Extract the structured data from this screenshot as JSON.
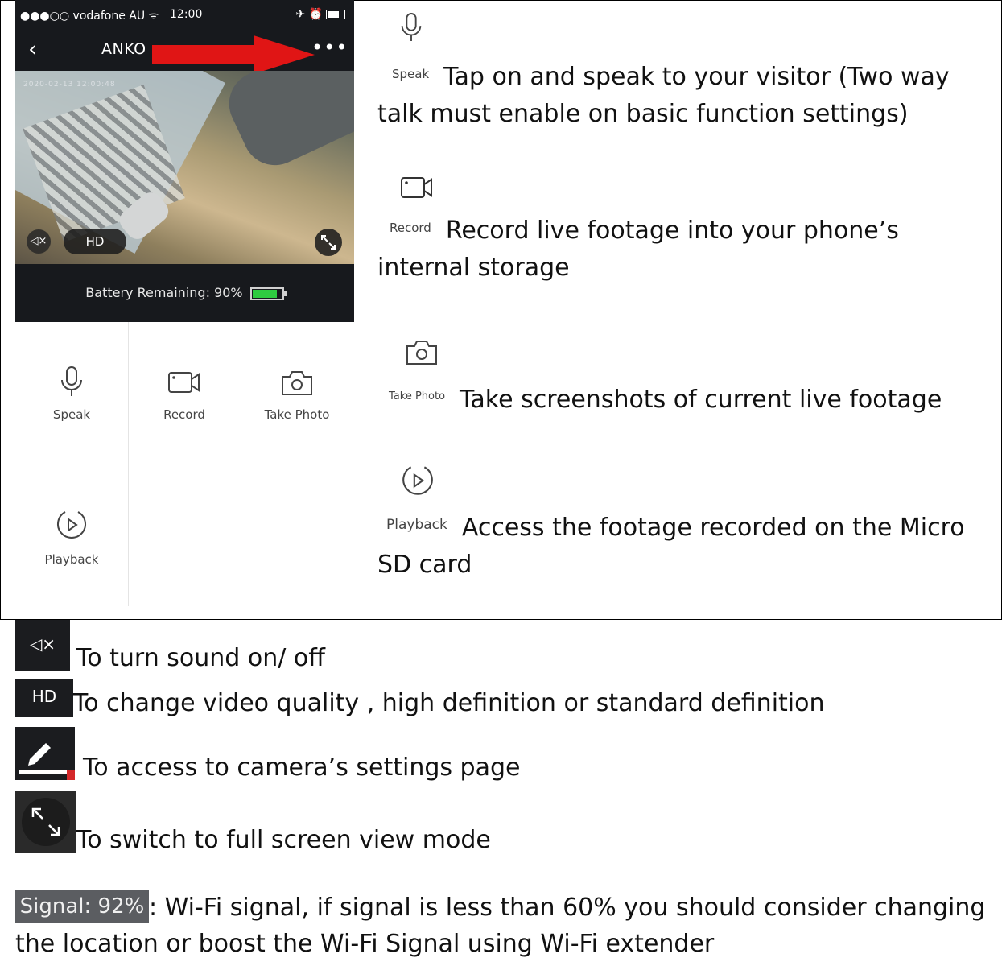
{
  "phone": {
    "status_carrier": "●●●○○ vodafone AU ᯤ",
    "status_time": "12:00",
    "status_right": "✈ ⏰",
    "back_glyph": "‹",
    "nav_title": "ANKO",
    "more_glyph": "•••",
    "video_timestamp": "2020-02-13 12:00:48",
    "mute_glyph": "◁×",
    "hd_label": "HD",
    "battery_label": "Battery Remaining: 90%",
    "battery_level_percent": 90,
    "tiles": [
      {
        "label": "Speak",
        "icon": "microphone-icon"
      },
      {
        "label": "Record",
        "icon": "video-camera-icon"
      },
      {
        "label": "Take Photo",
        "icon": "camera-icon"
      },
      {
        "label": "Playback",
        "icon": "playback-icon"
      }
    ]
  },
  "features": [
    {
      "icon_label": "Speak",
      "icon": "microphone-icon",
      "line1": "Tap on and speak to your visitor (Two way",
      "line2": "talk must enable on basic function settings)"
    },
    {
      "icon_label": "Record",
      "icon": "video-camera-icon",
      "line1": "Record live footage into your phone’s",
      "line2": "internal storage"
    },
    {
      "icon_label": "Take Photo",
      "icon": "camera-icon",
      "line1": "Take screenshots of current live footage",
      "line2": ""
    },
    {
      "icon_label": "Playback",
      "icon": "playback-icon",
      "line1": "Access the footage recorded on the Micro",
      "line2": "SD card"
    }
  ],
  "legend": [
    {
      "icon": "mute-icon",
      "icon_text": "◁×",
      "text": "To turn sound on/ off"
    },
    {
      "icon": "hd-icon",
      "icon_text": "HD",
      "text": "To change video quality , high definition or standard definition"
    },
    {
      "icon": "edit-pencil-icon",
      "icon_text": "",
      "text": "To access to camera’s settings page"
    },
    {
      "icon": "fullscreen-icon",
      "icon_text": "",
      "text": "To switch to full screen view mode"
    }
  ],
  "signal": {
    "chip": "Signal: 92%",
    "line1": ": Wi-Fi signal, if signal is less than 60% you should consider changing",
    "line2": "the location or boost the Wi-Fi Signal using Wi-Fi extender"
  },
  "colors": {
    "arrow": "#e01515",
    "battery_fill": "#2ecc40",
    "dark_bg": "#17191d"
  }
}
